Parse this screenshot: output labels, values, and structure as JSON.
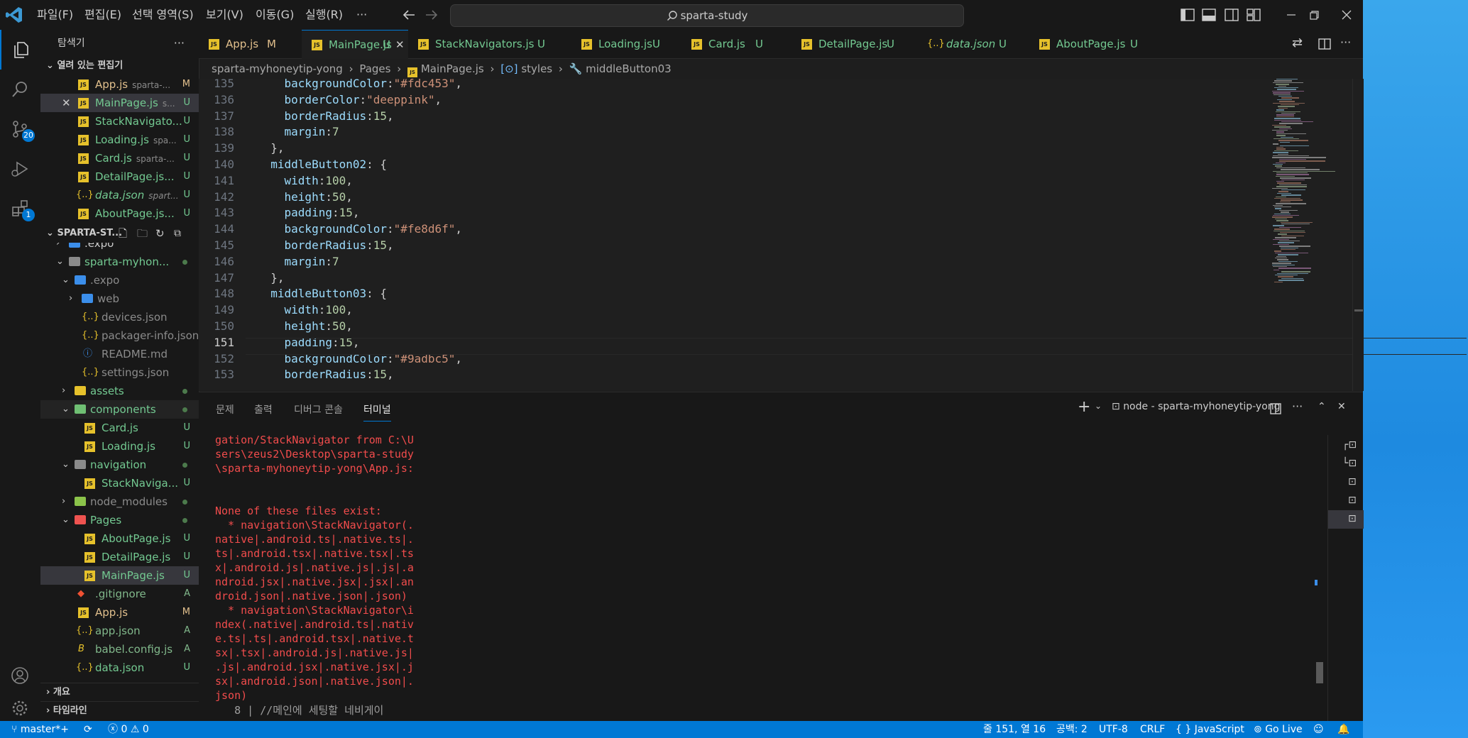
{
  "titlebar": {
    "menus": [
      "파일(F)",
      "편집(E)",
      "선택 영역(S)",
      "보기(V)",
      "이동(G)",
      "실행(R)",
      "···"
    ],
    "search": "sparta-study"
  },
  "activity": {
    "scm_badge": "20",
    "ext_badge": "1"
  },
  "sidebar": {
    "title": "탐색기",
    "open_editors_title": "열려 있는 편집기",
    "open_editors": [
      {
        "name": "App.js",
        "sub": "sparta-...",
        "status": "M"
      },
      {
        "name": "MainPage.js",
        "sub": "s...",
        "status": "U"
      },
      {
        "name": "StackNavigato...",
        "sub": "",
        "status": "U"
      },
      {
        "name": "Loading.js",
        "sub": "spa...",
        "status": "U"
      },
      {
        "name": "Card.js",
        "sub": "sparta-...",
        "status": "U"
      },
      {
        "name": "DetailPage.js...",
        "sub": "",
        "status": "U"
      },
      {
        "name": "data.json",
        "sub": "spart...",
        "status": "U"
      },
      {
        "name": "AboutPage.js...",
        "sub": "",
        "status": "U"
      }
    ],
    "project_title": "SPARTA-ST...",
    "tree": [
      {
        "name": ".expo",
        "status": ""
      },
      {
        "name": "sparta-myhon...",
        "status": "●"
      },
      {
        "name": ".expo",
        "status": ""
      },
      {
        "name": "web",
        "status": ""
      },
      {
        "name": "devices.json",
        "status": ""
      },
      {
        "name": "packager-info.json",
        "status": ""
      },
      {
        "name": "README.md",
        "status": ""
      },
      {
        "name": "settings.json",
        "status": ""
      },
      {
        "name": "assets",
        "status": "●"
      },
      {
        "name": "components",
        "status": "●"
      },
      {
        "name": "Card.js",
        "status": "U"
      },
      {
        "name": "Loading.js",
        "status": "U"
      },
      {
        "name": "navigation",
        "status": "●"
      },
      {
        "name": "StackNaviga...",
        "status": "U"
      },
      {
        "name": "node_modules",
        "status": "●"
      },
      {
        "name": "Pages",
        "status": "●"
      },
      {
        "name": "AboutPage.js",
        "status": "U"
      },
      {
        "name": "DetailPage.js",
        "status": "U"
      },
      {
        "name": "MainPage.js",
        "status": "U"
      },
      {
        "name": ".gitignore",
        "status": "A"
      },
      {
        "name": "App.js",
        "status": "M"
      },
      {
        "name": "app.json",
        "status": "A"
      },
      {
        "name": "babel.config.js",
        "status": "A"
      },
      {
        "name": "data.json",
        "status": "U"
      }
    ],
    "outline": "개요",
    "timeline": "타임라인"
  },
  "tabs": [
    {
      "name": "App.js",
      "status": "M"
    },
    {
      "name": "MainPage.js",
      "status": "U"
    },
    {
      "name": "StackNavigators.js",
      "status": "U"
    },
    {
      "name": "Loading.js",
      "status": "U"
    },
    {
      "name": "Card.js",
      "status": "U"
    },
    {
      "name": "DetailPage.js",
      "status": "U"
    },
    {
      "name": "data.json",
      "status": "U"
    },
    {
      "name": "AboutPage.js",
      "status": "U"
    }
  ],
  "breadcrumb": [
    "sparta-myhoneytip-yong",
    "Pages",
    "MainPage.js",
    "styles",
    "middleButton03"
  ],
  "editor": {
    "lines": [
      {
        "n": "135",
        "t": "    backgroundColor:\"#fdc453\","
      },
      {
        "n": "136",
        "t": "    borderColor:\"deeppink\","
      },
      {
        "n": "137",
        "t": "    borderRadius:15,"
      },
      {
        "n": "138",
        "t": "    margin:7"
      },
      {
        "n": "139",
        "t": "  },"
      },
      {
        "n": "140",
        "t": "  middleButton02: {"
      },
      {
        "n": "141",
        "t": "    width:100,"
      },
      {
        "n": "142",
        "t": "    height:50,"
      },
      {
        "n": "143",
        "t": "    padding:15,"
      },
      {
        "n": "144",
        "t": "    backgroundColor:\"#fe8d6f\","
      },
      {
        "n": "145",
        "t": "    borderRadius:15,"
      },
      {
        "n": "146",
        "t": "    margin:7"
      },
      {
        "n": "147",
        "t": "  },"
      },
      {
        "n": "148",
        "t": "  middleButton03: {"
      },
      {
        "n": "149",
        "t": "    width:100,"
      },
      {
        "n": "150",
        "t": "    height:50,"
      },
      {
        "n": "151",
        "t": "    padding:15,"
      },
      {
        "n": "152",
        "t": "    backgroundColor:\"#9adbc5\","
      },
      {
        "n": "153",
        "t": "    borderRadius:15,"
      }
    ]
  },
  "panel": {
    "tabs": [
      "문제",
      "출력",
      "디버그 콘솔",
      "터미널"
    ],
    "terminal_name": "node - sparta-myhoneytip-yong",
    "terminal_text": "gation/StackNavigator from C:\\U\nsers\\zeus2\\Desktop\\sparta-study\n\\sparta-myhoneytip-yong\\App.js:\n\n\nNone of these files exist:\n  * navigation\\StackNavigator(.\nnative|.android.ts|.native.ts|.\nts|.android.tsx|.native.tsx|.ts\nx|.android.js|.native.js|.js|.a\nndroid.jsx|.native.jsx|.jsx|.an\ndroid.json|.native.json|.json)\n  * navigation\\StackNavigator\\i\nndex(.native|.android.ts|.nativ\ne.ts|.ts|.android.tsx|.native.t\nsx|.tsx|.android.js|.native.js|\n.js|.android.jsx|.native.jsx|.j\nsx|.android.json|.native.json|.\njson)",
    "terminal_last": "   8 | //메인에 세팅할 네비게이"
  },
  "status": {
    "branch": "master*+",
    "errors": "0",
    "warnings": "0",
    "position": "줄 151, 열 16",
    "spaces": "공백: 2",
    "encoding": "UTF-8",
    "eol": "CRLF",
    "language": "JavaScript",
    "golive": "Go Live"
  },
  "colors": {
    "accent": "#0078d4",
    "js": "#e6c12b",
    "untracked": "#73c991",
    "modified": "#e2c08d",
    "error": "#f14c4c"
  }
}
